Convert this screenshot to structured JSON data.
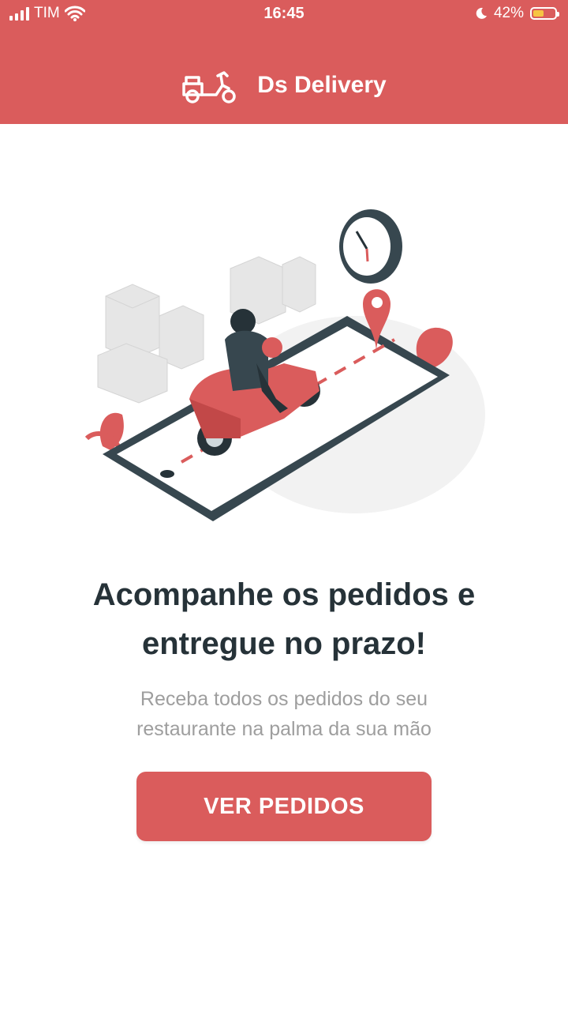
{
  "status_bar": {
    "carrier": "TIM",
    "time": "16:45",
    "battery": "42%",
    "icons": [
      "signal-bars-icon",
      "wifi-icon",
      "moon-icon",
      "battery-icon"
    ]
  },
  "header": {
    "title": "Ds Delivery",
    "logo_icon": "scooter-icon",
    "background_color": "#DA5C5C"
  },
  "hero": {
    "illustration": "delivery-scooter-on-phone-illustration",
    "headline_line1": "Acompanhe os pedidos e",
    "headline_line2": "entregue no prazo!",
    "subtitle_line1": "Receba todos os pedidos do seu",
    "subtitle_line2": "restaurante na palma da sua mão"
  },
  "cta": {
    "label": "VER PEDIDOS",
    "color": "#DA5C5C"
  }
}
